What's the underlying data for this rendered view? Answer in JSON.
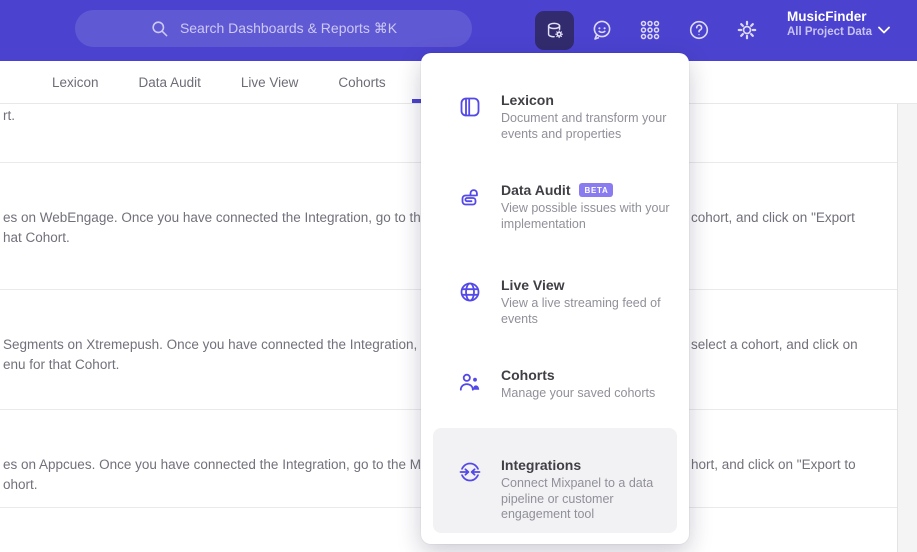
{
  "colors": {
    "header_bg": "#4b43cf",
    "accent": "#4b43cf",
    "icon_purple": "#5348e8",
    "beta_badge_bg": "#8a7cf0",
    "menu_highlight_bg": "#f2f2f4"
  },
  "header": {
    "search_placeholder": "Search Dashboards & Reports ⌘K",
    "project_name": "MusicFinder",
    "project_scope": "All Project Data"
  },
  "tabs": [
    {
      "label": "Lexicon"
    },
    {
      "label": "Data Audit"
    },
    {
      "label": "Live View"
    },
    {
      "label": "Cohorts"
    }
  ],
  "content_rows": [
    {
      "l1_left": "rt.",
      "l1_right": "",
      "l2_left": "",
      "l2_right": ""
    },
    {
      "l1_left": "es on WebEngage. Once you have connected the Integration, go to the",
      "l1_right": "cohort, and click on \"Export",
      "l2_left": "hat Cohort.",
      "l2_right": ""
    },
    {
      "l1_left": "Segments on Xtremepush. Once you have connected the Integration,",
      "l1_right": "select a cohort, and click on",
      "l2_left": "enu for that Cohort.",
      "l2_right": ""
    },
    {
      "l1_left": "es on Appcues. Once you have connected the Integration, go to the M",
      "l1_right": "hort, and click on \"Export to",
      "l2_left": "ohort.",
      "l2_right": ""
    }
  ],
  "menu": {
    "items": [
      {
        "title": "Lexicon",
        "badge": "",
        "description": "Document and transform your events and properties",
        "icon": "book-icon"
      },
      {
        "title": "Data Audit",
        "badge": "BETA",
        "description": "View possible issues with your implementation",
        "icon": "audit-lock-icon"
      },
      {
        "title": "Live View",
        "badge": "",
        "description": "View a live streaming feed of events",
        "icon": "globe-icon"
      },
      {
        "title": "Cohorts",
        "badge": "",
        "description": "Manage your saved cohorts",
        "icon": "people-icon"
      },
      {
        "title": "Integrations",
        "badge": "",
        "description": "Connect Mixpanel to a data pipeline or customer engagement tool",
        "icon": "sync-arrows-icon",
        "highlighted": true
      }
    ]
  }
}
